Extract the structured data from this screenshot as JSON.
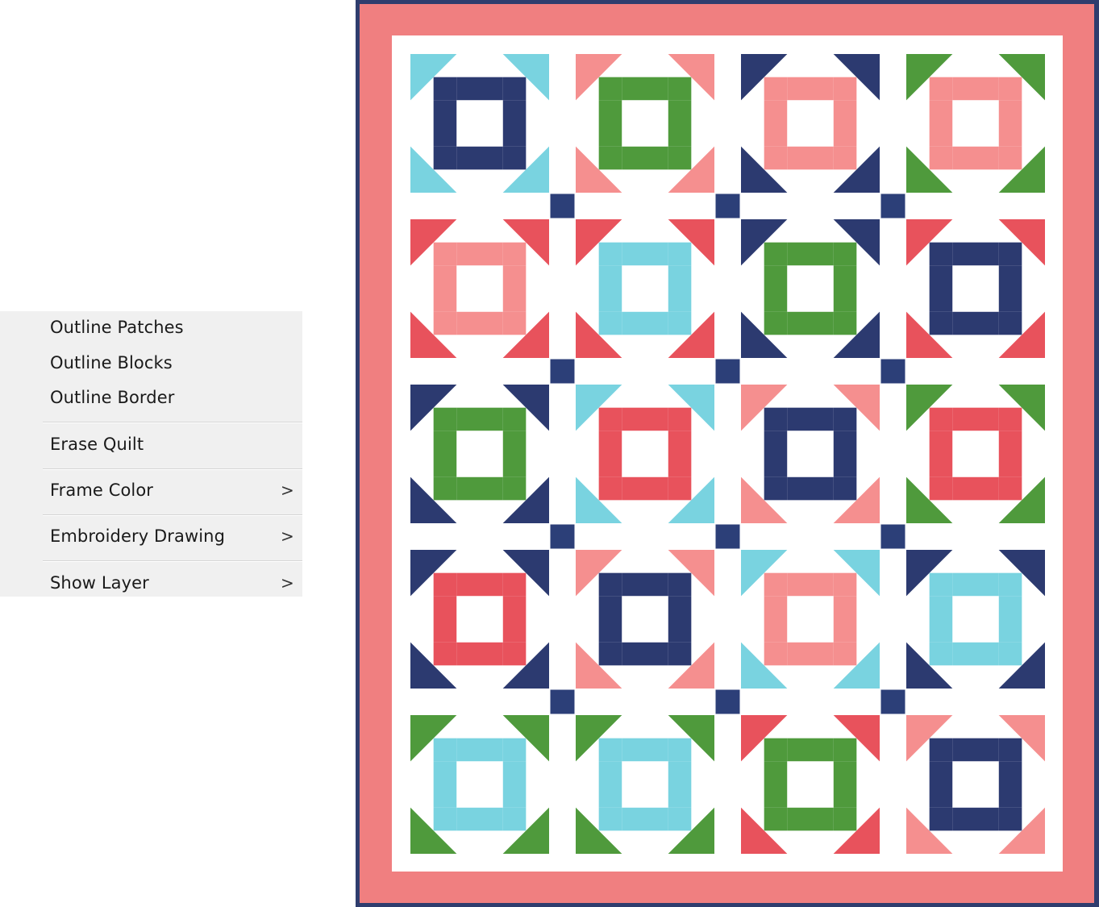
{
  "menu": {
    "items": [
      {
        "label": "Outline Patches"
      },
      {
        "label": "Outline Blocks"
      },
      {
        "label": "Outline Border"
      },
      {
        "label": "Erase Quilt"
      },
      {
        "label": "Frame Color",
        "submenu_arrow": ">"
      },
      {
        "label": "Embroidery Drawing",
        "submenu_arrow": ">"
      },
      {
        "label": "Show Layer",
        "submenu_arrow": ">"
      }
    ]
  },
  "quilt": {
    "colors": {
      "binding": "#2f3d6e",
      "border": "#f07f80",
      "background": "#ffffff",
      "cornerstone": "#2c3f78",
      "navy": "#2c3a70",
      "aqua": "#79d3e0",
      "green": "#4f9a3c",
      "pink": "#f58f8f",
      "red": "#e8525c"
    },
    "rows": [
      [
        {
          "corner": "aqua",
          "bar": "navy"
        },
        {
          "corner": "pink",
          "bar": "green"
        },
        {
          "corner": "navy",
          "bar": "pink"
        },
        {
          "corner": "green",
          "bar": "pink"
        }
      ],
      [
        {
          "corner": "red",
          "bar": "pink"
        },
        {
          "corner": "red",
          "bar": "aqua"
        },
        {
          "corner": "navy",
          "bar": "green"
        },
        {
          "corner": "red",
          "bar": "navy"
        }
      ],
      [
        {
          "corner": "navy",
          "bar": "green"
        },
        {
          "corner": "aqua",
          "bar": "red"
        },
        {
          "corner": "pink",
          "bar": "navy"
        },
        {
          "corner": "green",
          "bar": "red"
        }
      ],
      [
        {
          "corner": "navy",
          "bar": "red"
        },
        {
          "corner": "pink",
          "bar": "navy"
        },
        {
          "corner": "aqua",
          "bar": "pink"
        },
        {
          "corner": "navy",
          "bar": "aqua"
        }
      ],
      [
        {
          "corner": "green",
          "bar": "aqua"
        },
        {
          "corner": "green",
          "bar": "aqua"
        },
        {
          "corner": "red",
          "bar": "green"
        },
        {
          "corner": "pink",
          "bar": "navy"
        }
      ]
    ]
  }
}
